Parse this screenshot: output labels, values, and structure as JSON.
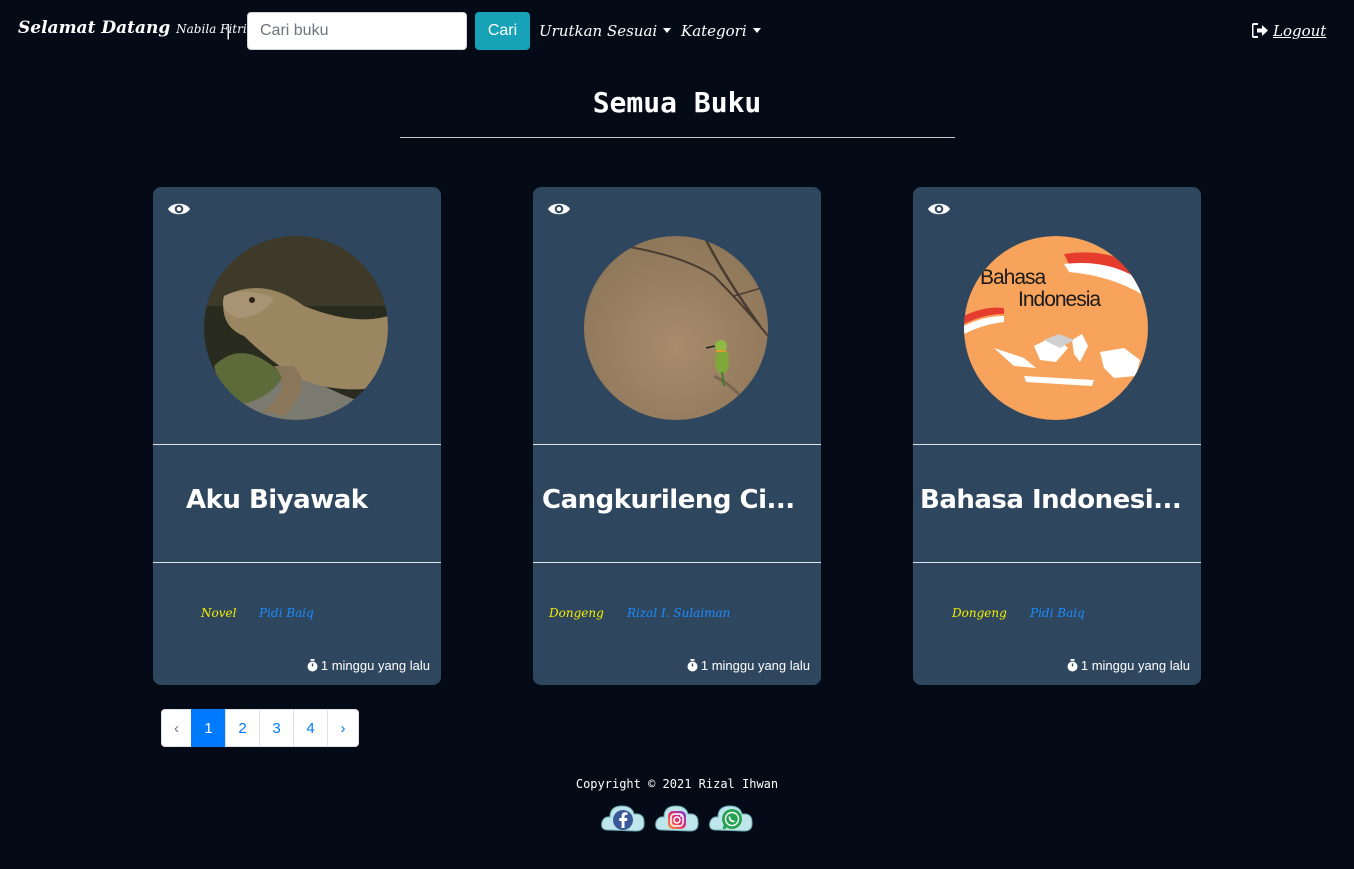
{
  "navbar": {
    "brand_greeting": "Selamat Datang",
    "brand_name": "Nabila Fitriani",
    "separator": "|",
    "search_placeholder": "Cari buku",
    "search_button": "Cari",
    "sort_label": "Urutkan Sesuai",
    "category_label": "Kategori",
    "logout_label": "Logout"
  },
  "page_title": "Semua Buku",
  "books": [
    {
      "title": "Aku Biyawak",
      "category": "Novel",
      "author": "Pidi Baiq",
      "time": "1 minggu yang lalu",
      "cover_icon": "komodo-image"
    },
    {
      "title": "Cangkurileng Ci...",
      "category": "Dongeng",
      "author": "Rizal I. Sulaiman",
      "time": "1 minggu yang lalu",
      "cover_icon": "bird-image"
    },
    {
      "title": "Bahasa Indonesi...",
      "category": "Dongeng",
      "author": "Pidi Baiq",
      "time": "1 minggu yang lalu",
      "cover_icon": "bahasa-indonesia-image",
      "cover_text_1": "Bahasa",
      "cover_text_2": "Indonesia"
    }
  ],
  "pagination": {
    "prev": "‹",
    "pages": [
      "1",
      "2",
      "3",
      "4"
    ],
    "next": "›",
    "active": "1"
  },
  "footer": {
    "copyright": "Copyright © 2021 Rizal Ihwan",
    "social": [
      "facebook-icon",
      "instagram-icon",
      "whatsapp-icon"
    ]
  },
  "colors": {
    "background": "#040b17",
    "card": "#2f465f",
    "search_button": "#17a2b8",
    "category": "#f3f000",
    "author": "#1a8cff",
    "page_active": "#007bff"
  }
}
